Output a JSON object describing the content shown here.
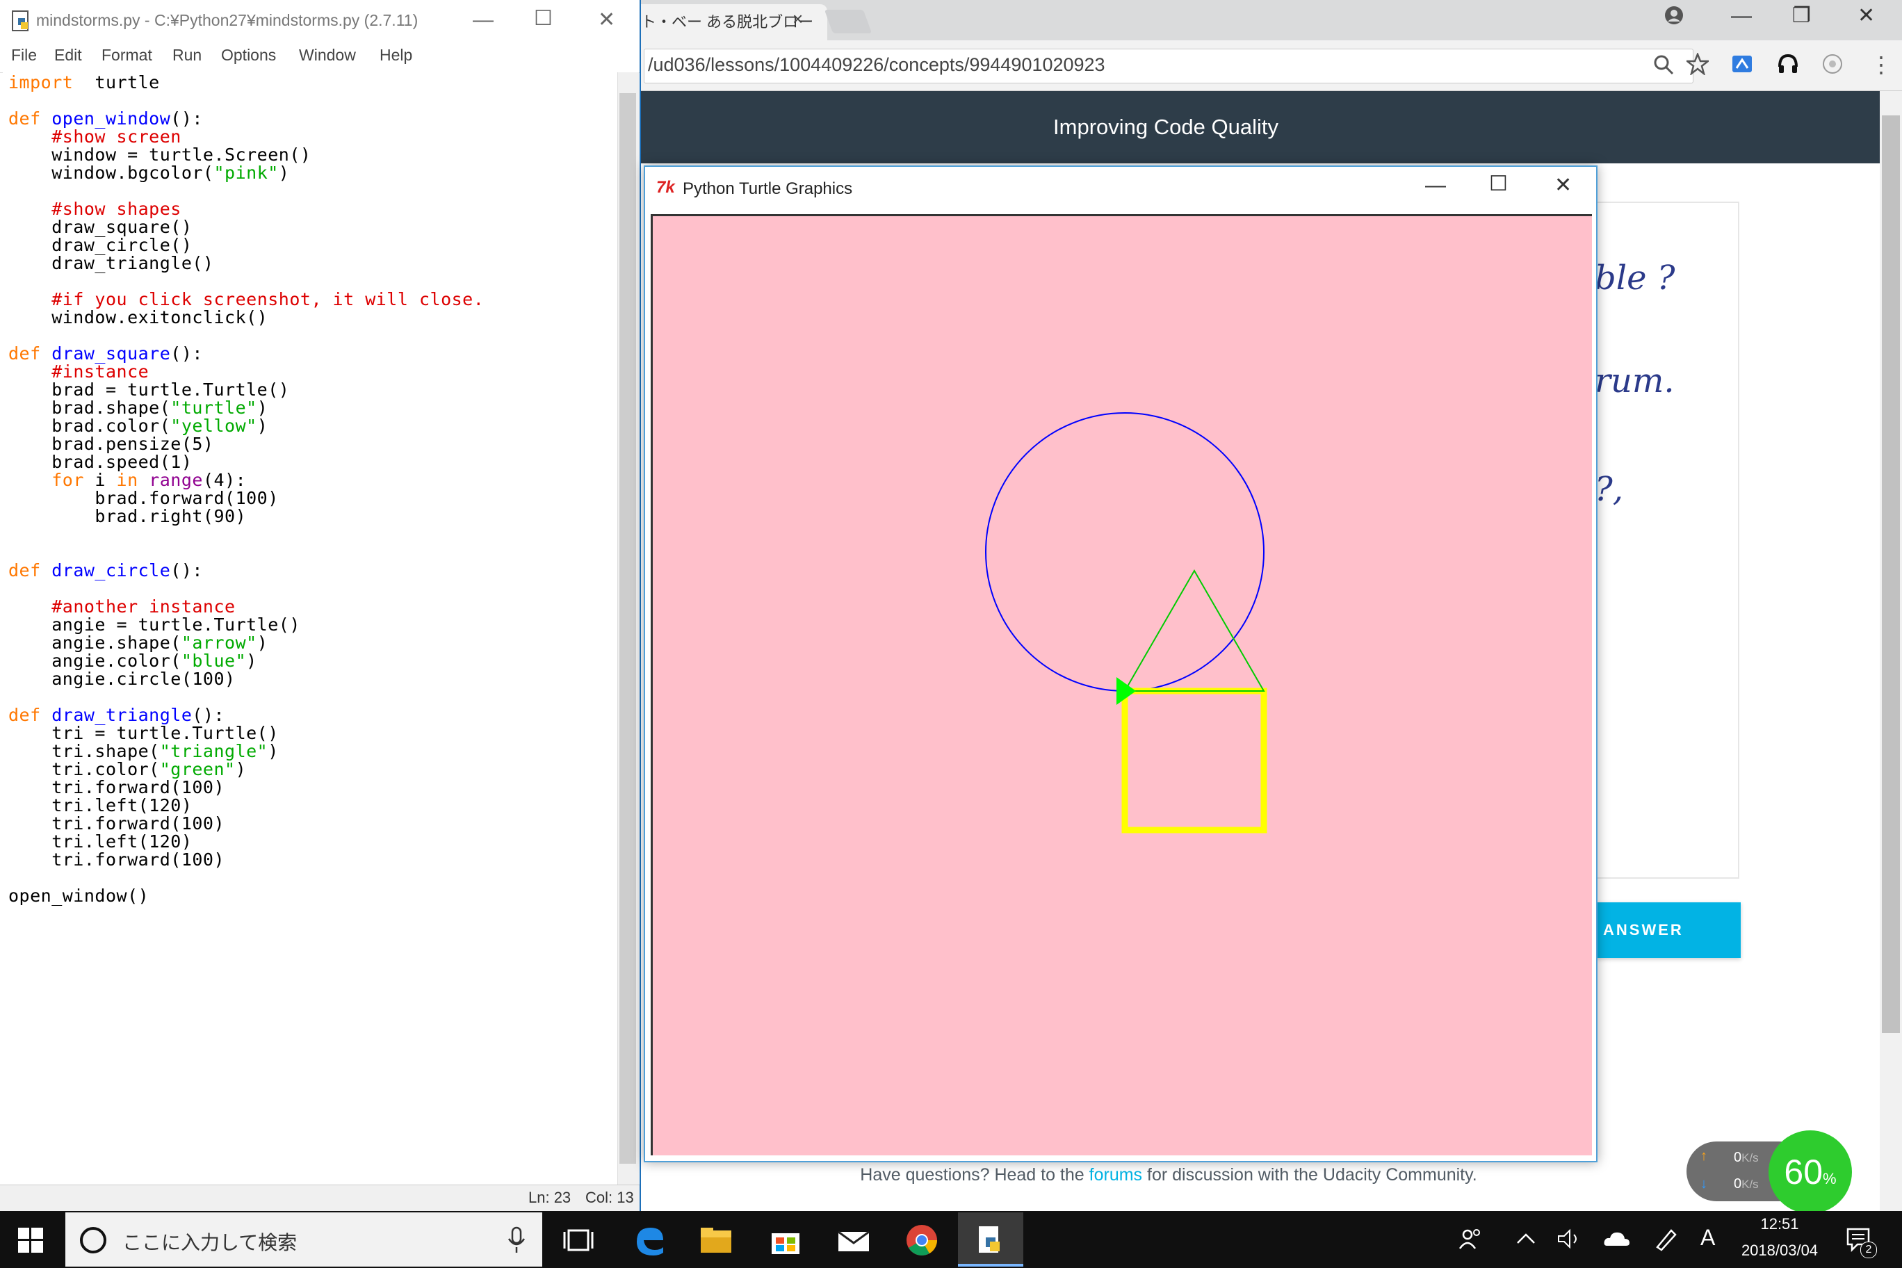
{
  "browser": {
    "tab_title": "ト・ベー ある脱北ブロー",
    "tab_close": "×",
    "url": "/ud036/lessons/1004409226/concepts/9944901020923",
    "header_title": "Improving Code Quality",
    "handwritten_lines": [
      "ble ?",
      "rum.",
      "?,"
    ],
    "answer_label": "ANSWER",
    "forum_prefix": "Have questions? Head to the ",
    "forum_link": "forums",
    "forum_suffix": " for discussion with the Udacity Community.",
    "min_glyph": "—",
    "restore_glyph": "❐",
    "close_glyph": "✕",
    "menu_glyph": "⋮"
  },
  "net_widget": {
    "up": "0",
    "up_unit": "K/s",
    "down": "0",
    "down_unit": "K/s",
    "percent": "60",
    "percent_sign": "%"
  },
  "idle": {
    "title": "mindstorms.py - C:¥Python27¥mindstorms.py (2.7.11)",
    "menu": [
      "File",
      "Edit",
      "Format",
      "Run",
      "Options",
      "Window",
      "Help"
    ],
    "status_ln": "Ln: 23",
    "status_col": "Col: 13",
    "min_glyph": "—",
    "max_glyph": "☐",
    "close_glyph": "✕",
    "code": [
      [
        [
          "kw",
          "import"
        ],
        [
          "",
          "  turtle"
        ]
      ],
      [],
      [
        [
          "kw",
          "def"
        ],
        [
          "",
          " "
        ],
        [
          "def",
          "open_window"
        ],
        [
          "",
          "():"
        ]
      ],
      [
        [
          "",
          "    "
        ],
        [
          "cm",
          "#show screen"
        ]
      ],
      [
        [
          "",
          "    window = turtle.Screen()"
        ]
      ],
      [
        [
          "",
          "    window.bgcolor("
        ],
        [
          "str",
          "\"pink\""
        ],
        [
          "",
          ")"
        ]
      ],
      [],
      [
        [
          "",
          "    "
        ],
        [
          "cm",
          "#show shapes"
        ]
      ],
      [
        [
          "",
          "    draw_square()"
        ]
      ],
      [
        [
          "",
          "    draw_circle()"
        ]
      ],
      [
        [
          "",
          "    draw_triangle()"
        ]
      ],
      [],
      [
        [
          "",
          "    "
        ],
        [
          "cm",
          "#if you click screenshot, it will close."
        ]
      ],
      [
        [
          "",
          "    window.exitonclick()"
        ]
      ],
      [],
      [
        [
          "kw",
          "def"
        ],
        [
          "",
          " "
        ],
        [
          "def",
          "draw_square"
        ],
        [
          "",
          "():"
        ]
      ],
      [
        [
          "",
          "    "
        ],
        [
          "cm",
          "#instance"
        ]
      ],
      [
        [
          "",
          "    brad = turtle.Turtle()"
        ]
      ],
      [
        [
          "",
          "    brad.shape("
        ],
        [
          "str",
          "\"turtle\""
        ],
        [
          "",
          ")"
        ]
      ],
      [
        [
          "",
          "    brad.color("
        ],
        [
          "str",
          "\"yellow\""
        ],
        [
          "",
          ")"
        ]
      ],
      [
        [
          "",
          "    brad.pensize(5)"
        ]
      ],
      [
        [
          "",
          "    brad.speed(1)"
        ]
      ],
      [
        [
          "",
          "    "
        ],
        [
          "kw",
          "for"
        ],
        [
          "",
          " i "
        ],
        [
          "kw",
          "in"
        ],
        [
          "",
          " "
        ],
        [
          "bi",
          "range"
        ],
        [
          "",
          "(4):"
        ]
      ],
      [
        [
          "",
          "        brad.forward(100)"
        ]
      ],
      [
        [
          "",
          "        brad.right(90)"
        ]
      ],
      [],
      [],
      [
        [
          "kw",
          "def"
        ],
        [
          "",
          " "
        ],
        [
          "def",
          "draw_circle"
        ],
        [
          "",
          "():"
        ]
      ],
      [],
      [
        [
          "",
          "    "
        ],
        [
          "cm",
          "#another instance"
        ]
      ],
      [
        [
          "",
          "    angie = turtle.Turtle()"
        ]
      ],
      [
        [
          "",
          "    angie.shape("
        ],
        [
          "str",
          "\"arrow\""
        ],
        [
          "",
          ")"
        ]
      ],
      [
        [
          "",
          "    angie.color("
        ],
        [
          "str",
          "\"blue\""
        ],
        [
          "",
          ")"
        ]
      ],
      [
        [
          "",
          "    angie.circle(100)"
        ]
      ],
      [],
      [
        [
          "kw",
          "def"
        ],
        [
          "",
          " "
        ],
        [
          "def",
          "draw_triangle"
        ],
        [
          "",
          "():"
        ]
      ],
      [
        [
          "",
          "    tri = turtle.Turtle()"
        ]
      ],
      [
        [
          "",
          "    tri.shape("
        ],
        [
          "str",
          "\"triangle\""
        ],
        [
          "",
          ")"
        ]
      ],
      [
        [
          "",
          "    tri.color("
        ],
        [
          "str",
          "\"green\""
        ],
        [
          "",
          ")"
        ]
      ],
      [
        [
          "",
          "    tri.forward(100)"
        ]
      ],
      [
        [
          "",
          "    tri.left(120)"
        ]
      ],
      [
        [
          "",
          "    tri.forward(100)"
        ]
      ],
      [
        [
          "",
          "    tri.left(120)"
        ]
      ],
      [
        [
          "",
          "    tri.forward(100)"
        ]
      ],
      [],
      [
        [
          "",
          "open_window()"
        ]
      ]
    ]
  },
  "turtle": {
    "title": "Python Turtle Graphics",
    "icon_text": "7k",
    "bg_color": "#ffc0cb",
    "circle_color": "#0000ff",
    "square_color": "#ffff00",
    "triangle_color": "#00cc00",
    "arrow_color": "#00ff00",
    "min_glyph": "—",
    "max_glyph": "☐",
    "close_glyph": "✕"
  },
  "taskbar": {
    "search_placeholder": "ここに入力して検索",
    "time": "12:51",
    "date": "2018/03/04",
    "ime": "A",
    "notif_count": "2"
  }
}
